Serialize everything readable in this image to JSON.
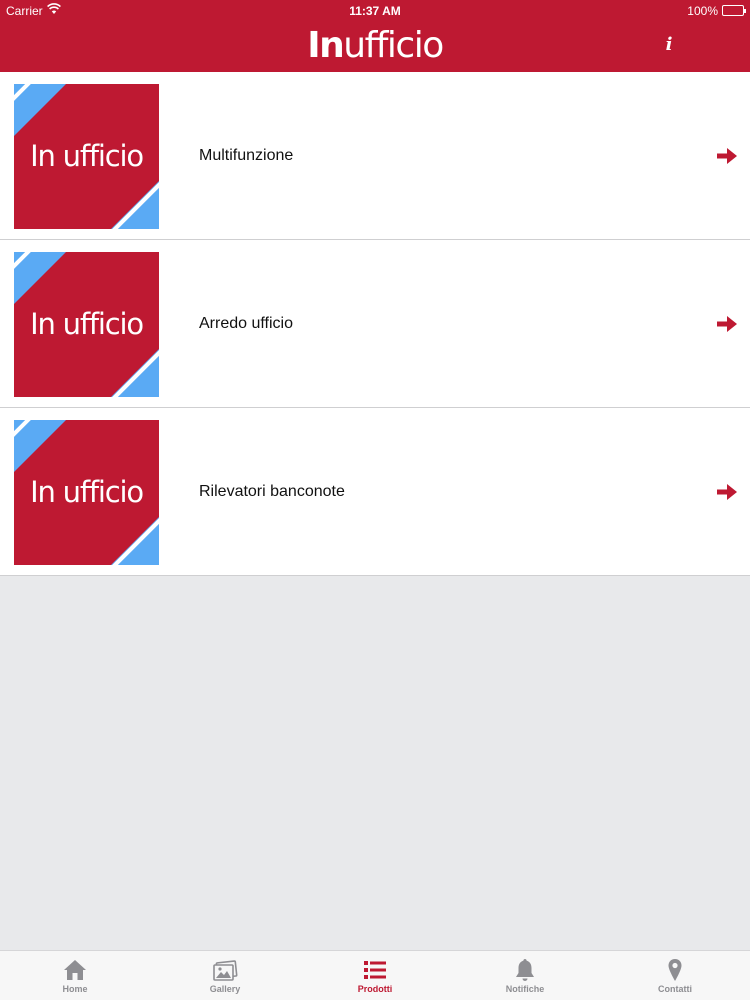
{
  "status_bar": {
    "carrier": "Carrier",
    "time": "11:37 AM",
    "battery": "100%"
  },
  "header": {
    "logo_bold": "In",
    "logo_rest": "ufficio",
    "info_label": "i"
  },
  "thumbnail_logo": "In ufficio",
  "list": {
    "items": [
      {
        "label": "Multifunzione",
        "icon": "arrow-right-icon"
      },
      {
        "label": "Arredo ufficio",
        "icon": "arrow-right-icon"
      },
      {
        "label": "Rilevatori banconote",
        "icon": "arrow-right-icon"
      }
    ]
  },
  "tabbar": {
    "tabs": [
      {
        "label": "Home",
        "icon": "home-icon"
      },
      {
        "label": "Gallery",
        "icon": "gallery-icon"
      },
      {
        "label": "Prodotti",
        "icon": "list-icon"
      },
      {
        "label": "Notifiche",
        "icon": "bell-icon"
      },
      {
        "label": "Contatti",
        "icon": "map-pin-icon"
      }
    ],
    "active_index": 2
  },
  "colors": {
    "brand_red": "#be1932",
    "accent_blue": "#5aaaf4",
    "inactive_gray": "#8e8e92"
  }
}
